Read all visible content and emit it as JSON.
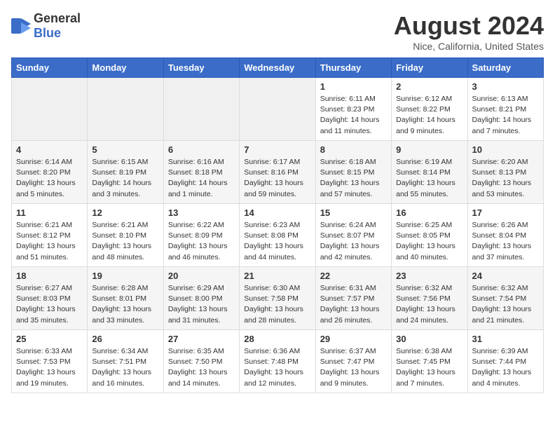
{
  "logo": {
    "general": "General",
    "blue": "Blue"
  },
  "header": {
    "title": "August 2024",
    "subtitle": "Nice, California, United States"
  },
  "days_of_week": [
    "Sunday",
    "Monday",
    "Tuesday",
    "Wednesday",
    "Thursday",
    "Friday",
    "Saturday"
  ],
  "weeks": [
    [
      {
        "day": "",
        "empty": true
      },
      {
        "day": "",
        "empty": true
      },
      {
        "day": "",
        "empty": true
      },
      {
        "day": "",
        "empty": true
      },
      {
        "day": "1",
        "sunrise": "6:11 AM",
        "sunset": "8:23 PM",
        "daylight": "14 hours and 11 minutes."
      },
      {
        "day": "2",
        "sunrise": "6:12 AM",
        "sunset": "8:22 PM",
        "daylight": "14 hours and 9 minutes."
      },
      {
        "day": "3",
        "sunrise": "6:13 AM",
        "sunset": "8:21 PM",
        "daylight": "14 hours and 7 minutes."
      }
    ],
    [
      {
        "day": "4",
        "sunrise": "6:14 AM",
        "sunset": "8:20 PM",
        "daylight": "13 hours and 5 minutes."
      },
      {
        "day": "5",
        "sunrise": "6:15 AM",
        "sunset": "8:19 PM",
        "daylight": "14 hours and 3 minutes."
      },
      {
        "day": "6",
        "sunrise": "6:16 AM",
        "sunset": "8:18 PM",
        "daylight": "14 hours and 1 minute."
      },
      {
        "day": "7",
        "sunrise": "6:17 AM",
        "sunset": "8:16 PM",
        "daylight": "13 hours and 59 minutes."
      },
      {
        "day": "8",
        "sunrise": "6:18 AM",
        "sunset": "8:15 PM",
        "daylight": "13 hours and 57 minutes."
      },
      {
        "day": "9",
        "sunrise": "6:19 AM",
        "sunset": "8:14 PM",
        "daylight": "13 hours and 55 minutes."
      },
      {
        "day": "10",
        "sunrise": "6:20 AM",
        "sunset": "8:13 PM",
        "daylight": "13 hours and 53 minutes."
      }
    ],
    [
      {
        "day": "11",
        "sunrise": "6:21 AM",
        "sunset": "8:12 PM",
        "daylight": "13 hours and 51 minutes."
      },
      {
        "day": "12",
        "sunrise": "6:21 AM",
        "sunset": "8:10 PM",
        "daylight": "13 hours and 48 minutes."
      },
      {
        "day": "13",
        "sunrise": "6:22 AM",
        "sunset": "8:09 PM",
        "daylight": "13 hours and 46 minutes."
      },
      {
        "day": "14",
        "sunrise": "6:23 AM",
        "sunset": "8:08 PM",
        "daylight": "13 hours and 44 minutes."
      },
      {
        "day": "15",
        "sunrise": "6:24 AM",
        "sunset": "8:07 PM",
        "daylight": "13 hours and 42 minutes."
      },
      {
        "day": "16",
        "sunrise": "6:25 AM",
        "sunset": "8:05 PM",
        "daylight": "13 hours and 40 minutes."
      },
      {
        "day": "17",
        "sunrise": "6:26 AM",
        "sunset": "8:04 PM",
        "daylight": "13 hours and 37 minutes."
      }
    ],
    [
      {
        "day": "18",
        "sunrise": "6:27 AM",
        "sunset": "8:03 PM",
        "daylight": "13 hours and 35 minutes."
      },
      {
        "day": "19",
        "sunrise": "6:28 AM",
        "sunset": "8:01 PM",
        "daylight": "13 hours and 33 minutes."
      },
      {
        "day": "20",
        "sunrise": "6:29 AM",
        "sunset": "8:00 PM",
        "daylight": "13 hours and 31 minutes."
      },
      {
        "day": "21",
        "sunrise": "6:30 AM",
        "sunset": "7:58 PM",
        "daylight": "13 hours and 28 minutes."
      },
      {
        "day": "22",
        "sunrise": "6:31 AM",
        "sunset": "7:57 PM",
        "daylight": "13 hours and 26 minutes."
      },
      {
        "day": "23",
        "sunrise": "6:32 AM",
        "sunset": "7:56 PM",
        "daylight": "13 hours and 24 minutes."
      },
      {
        "day": "24",
        "sunrise": "6:32 AM",
        "sunset": "7:54 PM",
        "daylight": "13 hours and 21 minutes."
      }
    ],
    [
      {
        "day": "25",
        "sunrise": "6:33 AM",
        "sunset": "7:53 PM",
        "daylight": "13 hours and 19 minutes."
      },
      {
        "day": "26",
        "sunrise": "6:34 AM",
        "sunset": "7:51 PM",
        "daylight": "13 hours and 16 minutes."
      },
      {
        "day": "27",
        "sunrise": "6:35 AM",
        "sunset": "7:50 PM",
        "daylight": "13 hours and 14 minutes."
      },
      {
        "day": "28",
        "sunrise": "6:36 AM",
        "sunset": "7:48 PM",
        "daylight": "13 hours and 12 minutes."
      },
      {
        "day": "29",
        "sunrise": "6:37 AM",
        "sunset": "7:47 PM",
        "daylight": "13 hours and 9 minutes."
      },
      {
        "day": "30",
        "sunrise": "6:38 AM",
        "sunset": "7:45 PM",
        "daylight": "13 hours and 7 minutes."
      },
      {
        "day": "31",
        "sunrise": "6:39 AM",
        "sunset": "7:44 PM",
        "daylight": "13 hours and 4 minutes."
      }
    ]
  ],
  "labels": {
    "sunrise": "Sunrise:",
    "sunset": "Sunset:",
    "daylight": "Daylight:"
  }
}
